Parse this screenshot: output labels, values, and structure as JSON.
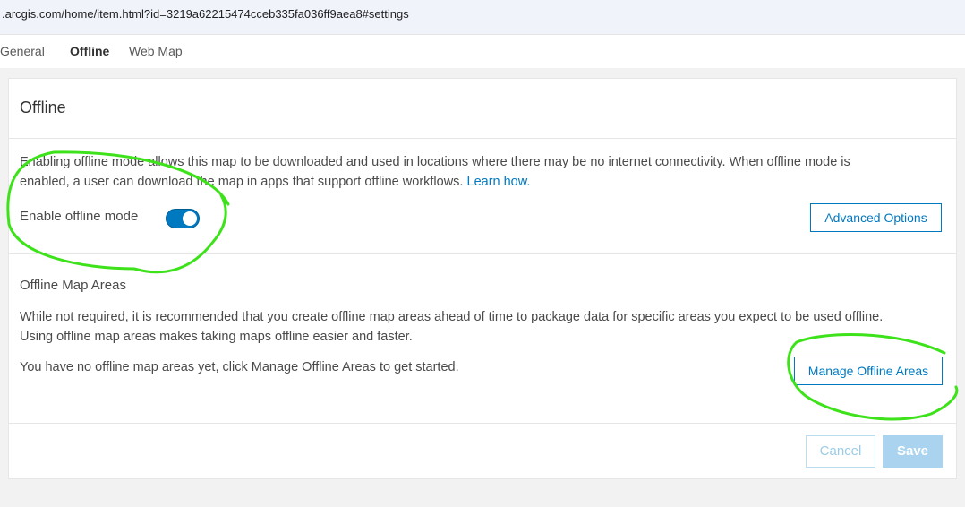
{
  "browser": {
    "url": ".arcgis.com/home/item.html?id=3219a62215474cceb335fa036ff9aea8#settings"
  },
  "tabs": [
    {
      "label": "General"
    },
    {
      "label": "Offline"
    },
    {
      "label": "Web Map"
    }
  ],
  "offline": {
    "title": "Offline",
    "description_line1": "Enabling offline mode allows this map to be downloaded and used in locations where there may be no internet connectivity. When offline mode is",
    "description_line2": "enabled, a user can download the map in apps that support offline workflows.",
    "learn_how_link": "Learn how.",
    "toggle_label": "Enable offline mode",
    "toggle_on": true,
    "advanced_options_button": "Advanced Options"
  },
  "map_areas": {
    "title": "Offline Map Areas",
    "description_line1": "While not required, it is recommended that you create offline map areas ahead of time to package data for specific areas you expect to be used offline.",
    "description_line2": "Using offline map areas makes taking maps offline easier and faster.",
    "empty_message": "You have no offline map areas yet, click Manage Offline Areas to get started.",
    "manage_button": "Manage Offline Areas"
  },
  "footer": {
    "cancel_label": "Cancel",
    "save_label": "Save"
  },
  "colors": {
    "accent": "#0079c1",
    "annotation": "#3de21a"
  }
}
